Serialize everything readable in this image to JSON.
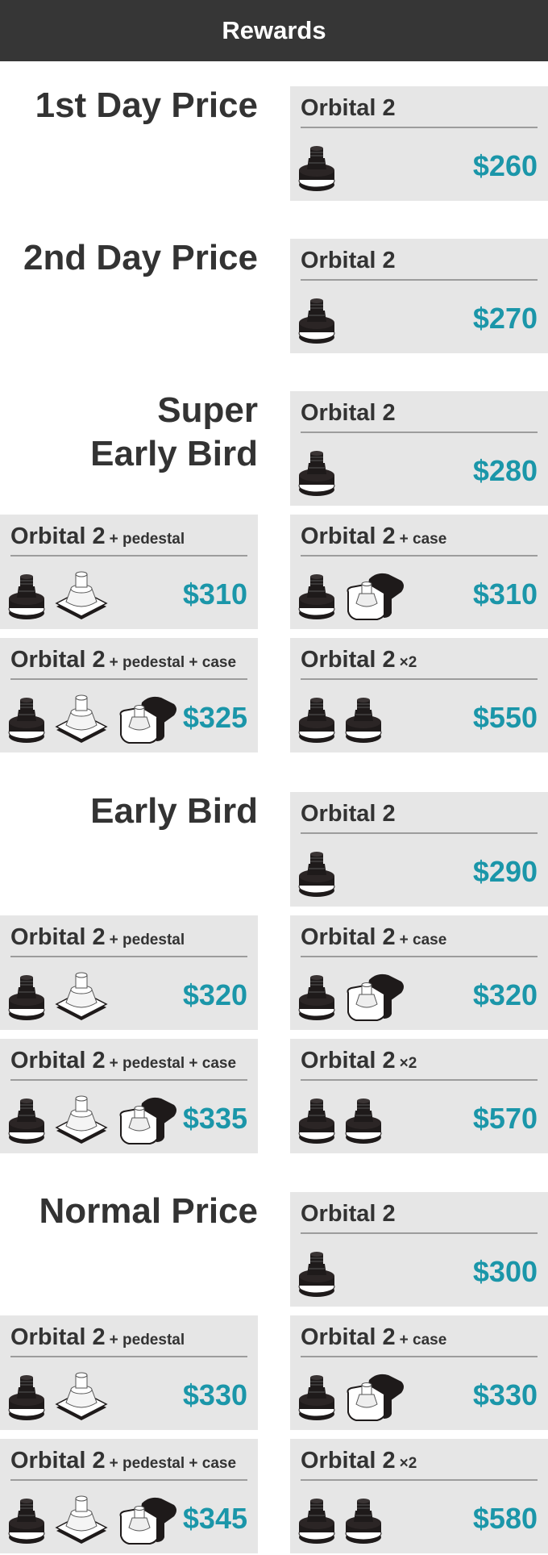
{
  "header": {
    "title": "Rewards"
  },
  "sections": [
    {
      "heading": [
        "1st Day Price"
      ],
      "cards": [
        {
          "name": "Orbital 2",
          "suffix": "",
          "icons": [
            "orbital-device-icon"
          ],
          "price": "$260"
        }
      ]
    },
    {
      "heading": [
        "2nd Day Price"
      ],
      "cards": [
        {
          "name": "Orbital 2",
          "suffix": "",
          "icons": [
            "orbital-device-icon"
          ],
          "price": "$270"
        }
      ]
    },
    {
      "heading": [
        "Super",
        "Early Bird"
      ],
      "cards": [
        {
          "name": "Orbital 2",
          "suffix": "",
          "icons": [
            "orbital-device-icon"
          ],
          "price": "$280"
        },
        {
          "name": "Orbital 2",
          "suffix": "+ pedestal",
          "icons": [
            "orbital-device-icon",
            "pedestal-icon"
          ],
          "price": "$310"
        },
        {
          "name": "Orbital 2",
          "suffix": "+ case",
          "icons": [
            "orbital-device-icon",
            "case-icon"
          ],
          "price": "$310"
        },
        {
          "name": "Orbital 2",
          "suffix": "+ pedestal + case",
          "icons": [
            "orbital-device-icon",
            "pedestal-icon",
            "case-icon"
          ],
          "price": "$325"
        },
        {
          "name": "Orbital 2",
          "suffix": "×2",
          "icons": [
            "orbital-device-icon",
            "orbital-device-icon"
          ],
          "price": "$550"
        }
      ]
    },
    {
      "heading": [
        "Early Bird"
      ],
      "cards": [
        {
          "name": "Orbital 2",
          "suffix": "",
          "icons": [
            "orbital-device-icon"
          ],
          "price": "$290"
        },
        {
          "name": "Orbital 2",
          "suffix": "+ pedestal",
          "icons": [
            "orbital-device-icon",
            "pedestal-icon"
          ],
          "price": "$320"
        },
        {
          "name": "Orbital 2",
          "suffix": "+ case",
          "icons": [
            "orbital-device-icon",
            "case-icon"
          ],
          "price": "$320"
        },
        {
          "name": "Orbital 2",
          "suffix": "+ pedestal + case",
          "icons": [
            "orbital-device-icon",
            "pedestal-icon",
            "case-icon"
          ],
          "price": "$335"
        },
        {
          "name": "Orbital 2",
          "suffix": "×2",
          "icons": [
            "orbital-device-icon",
            "orbital-device-icon"
          ],
          "price": "$570"
        }
      ]
    },
    {
      "heading": [
        "Normal Price"
      ],
      "cards": [
        {
          "name": "Orbital 2",
          "suffix": "",
          "icons": [
            "orbital-device-icon"
          ],
          "price": "$300"
        },
        {
          "name": "Orbital 2",
          "suffix": "+ pedestal",
          "icons": [
            "orbital-device-icon",
            "pedestal-icon"
          ],
          "price": "$330"
        },
        {
          "name": "Orbital 2",
          "suffix": "+ case",
          "icons": [
            "orbital-device-icon",
            "case-icon"
          ],
          "price": "$330"
        },
        {
          "name": "Orbital 2",
          "suffix": "+ pedestal + case",
          "icons": [
            "orbital-device-icon",
            "pedestal-icon",
            "case-icon"
          ],
          "price": "$345"
        },
        {
          "name": "Orbital 2",
          "suffix": "×2",
          "icons": [
            "orbital-device-icon",
            "orbital-device-icon"
          ],
          "price": "$580"
        }
      ]
    }
  ],
  "colors": {
    "header_bg": "#363636",
    "card_bg": "#e6e6e6",
    "price": "#1b96a9",
    "text": "#333333"
  }
}
